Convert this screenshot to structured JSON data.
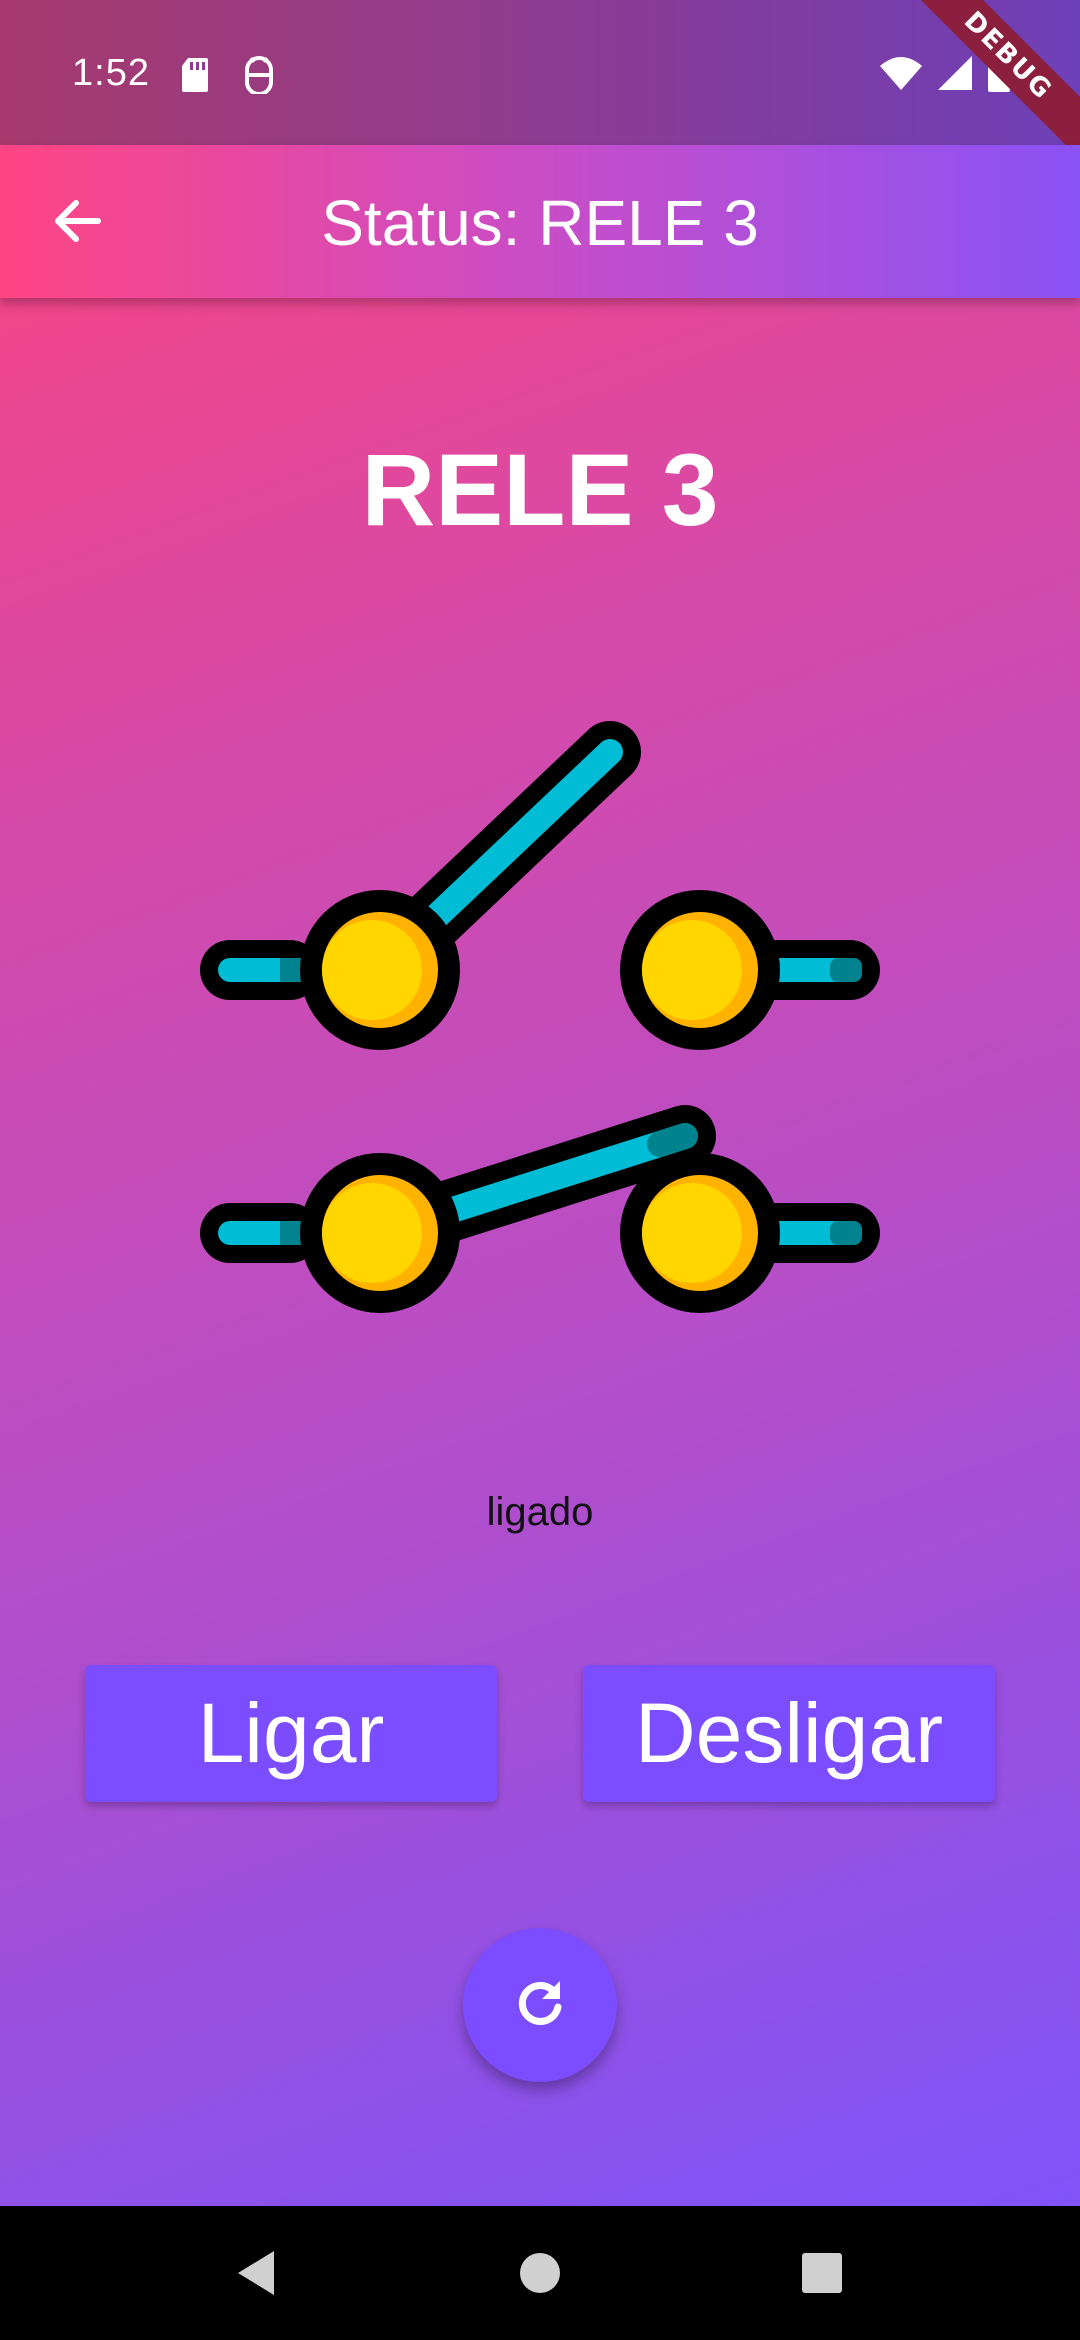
{
  "status_bar": {
    "time": "1:52",
    "left_icons": [
      "sd-card-icon",
      "android-debug-icon"
    ],
    "right_icons": [
      "wifi-icon",
      "cell-signal-icon",
      "battery-icon"
    ],
    "debug_banner": "DEBUG"
  },
  "app_bar": {
    "back_icon": "arrow-back-icon",
    "title": "Status: RELE 3"
  },
  "main": {
    "heading": "RELE 3",
    "illustration_icon": "relay-switch-icon",
    "status_text": "ligado",
    "buttons": {
      "on_label": "Ligar",
      "off_label": "Desligar"
    },
    "fab_icon": "refresh-icon"
  },
  "nav_bar": {
    "icons": [
      "nav-back-icon",
      "nav-home-icon",
      "nav-recents-icon"
    ]
  },
  "colors": {
    "accent": "#7c4dff",
    "gradient_start": "#ff4379",
    "gradient_end": "#7b54ff",
    "switch_fill": "#ffd600",
    "switch_bar": "#00bcd4"
  }
}
